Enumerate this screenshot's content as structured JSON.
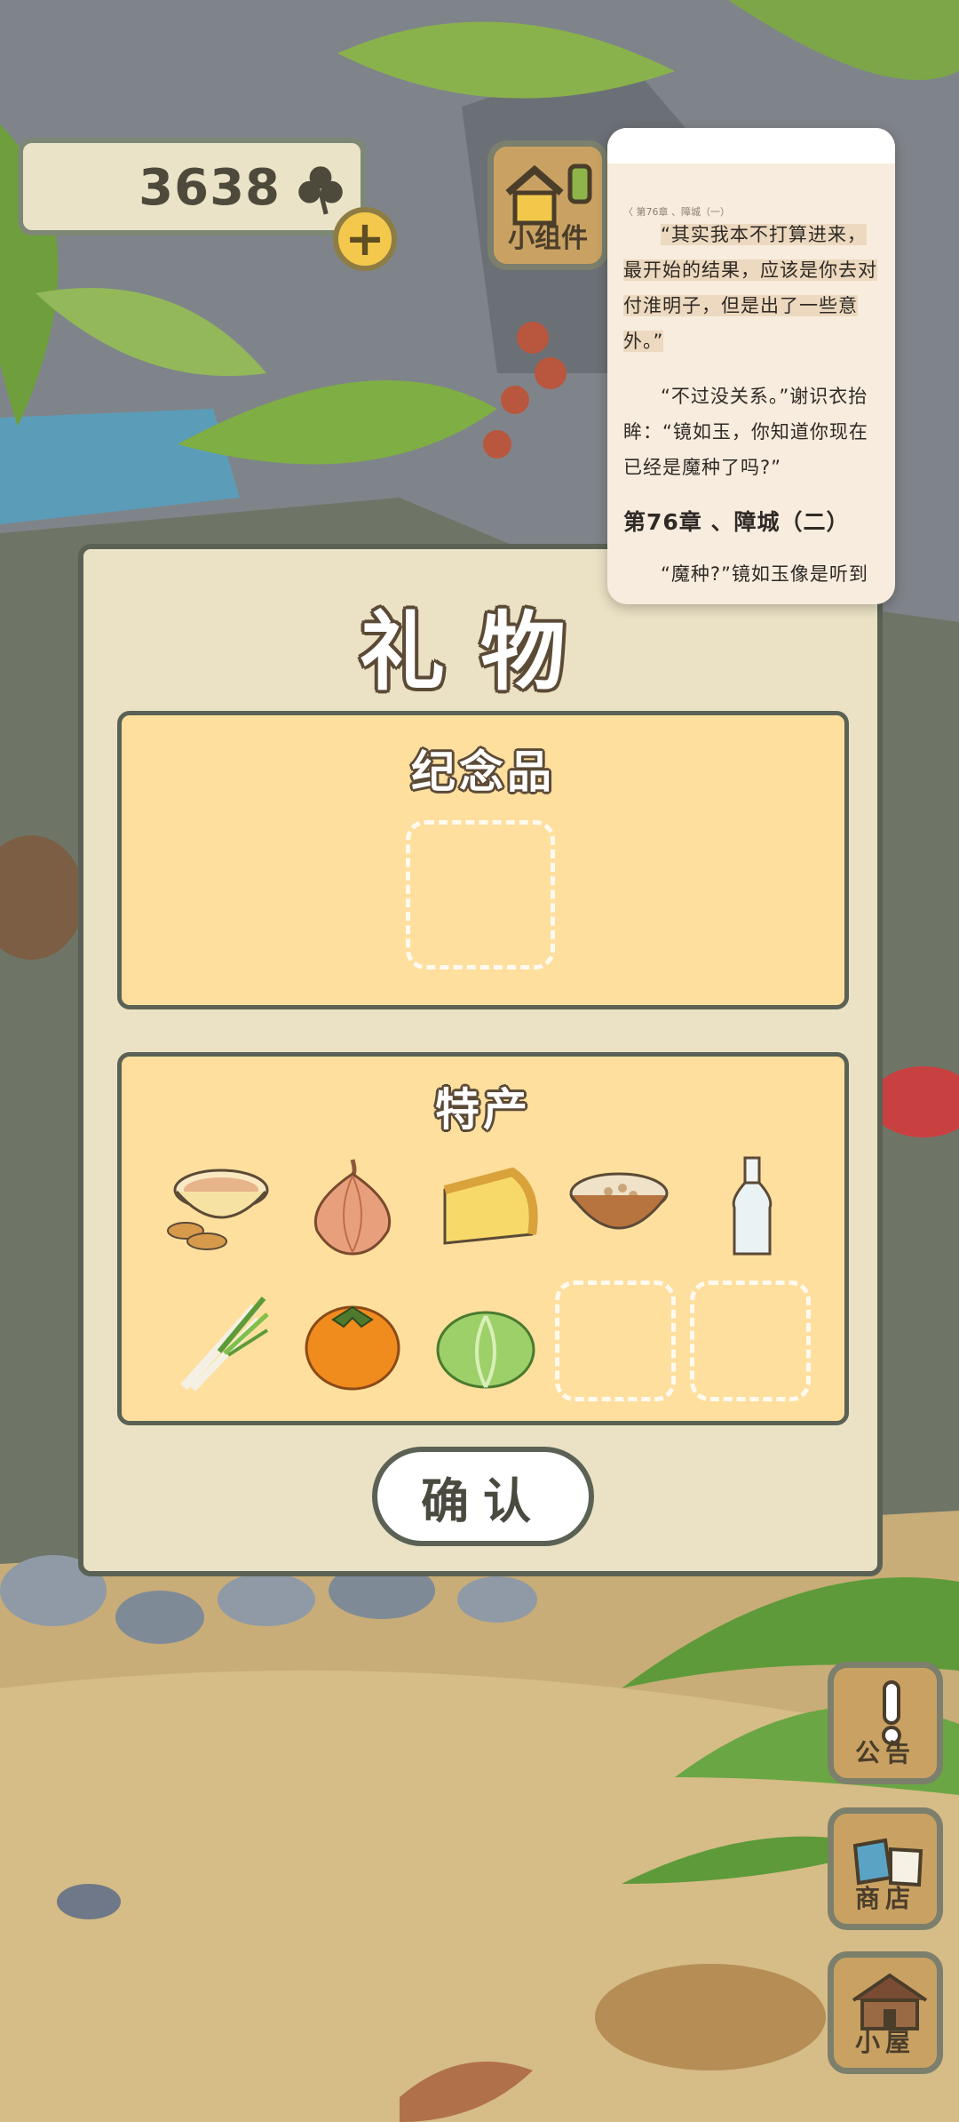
{
  "hud": {
    "clover_count": "3638",
    "widget_label": "小组件"
  },
  "side_menu": [
    {
      "label": "公告"
    },
    {
      "label": "商店"
    },
    {
      "label": "小屋"
    }
  ],
  "dialog": {
    "title": "礼物",
    "souvenir_section": "纪念品",
    "specialty_section": "特产",
    "confirm_label": "确认",
    "specialty_items": [
      {
        "icon": "tea-and-sweets-icon"
      },
      {
        "icon": "onion-icon"
      },
      {
        "icon": "cheese-icon"
      },
      {
        "icon": "porridge-bowl-icon"
      },
      {
        "icon": "bottle-icon"
      },
      {
        "icon": "green-onion-icon"
      },
      {
        "icon": "persimmon-icon"
      },
      {
        "icon": "cabbage-icon"
      }
    ]
  },
  "reader": {
    "header_left": "〈 第76章 、障城（一）",
    "header_right": "",
    "paragraphs": [
      "“其实我本不打算进来，最开始的结果，应该是你去对付淮明子，但是出了一些意外。”",
      "“不过没关系。”谢识衣抬眸：“镜如玉，你知道你现在已经是魔种了吗?”"
    ],
    "chapter_heading": "第76章 、障城（二）",
    "trailing_text": "“魔种?”镜如玉像是听到"
  }
}
